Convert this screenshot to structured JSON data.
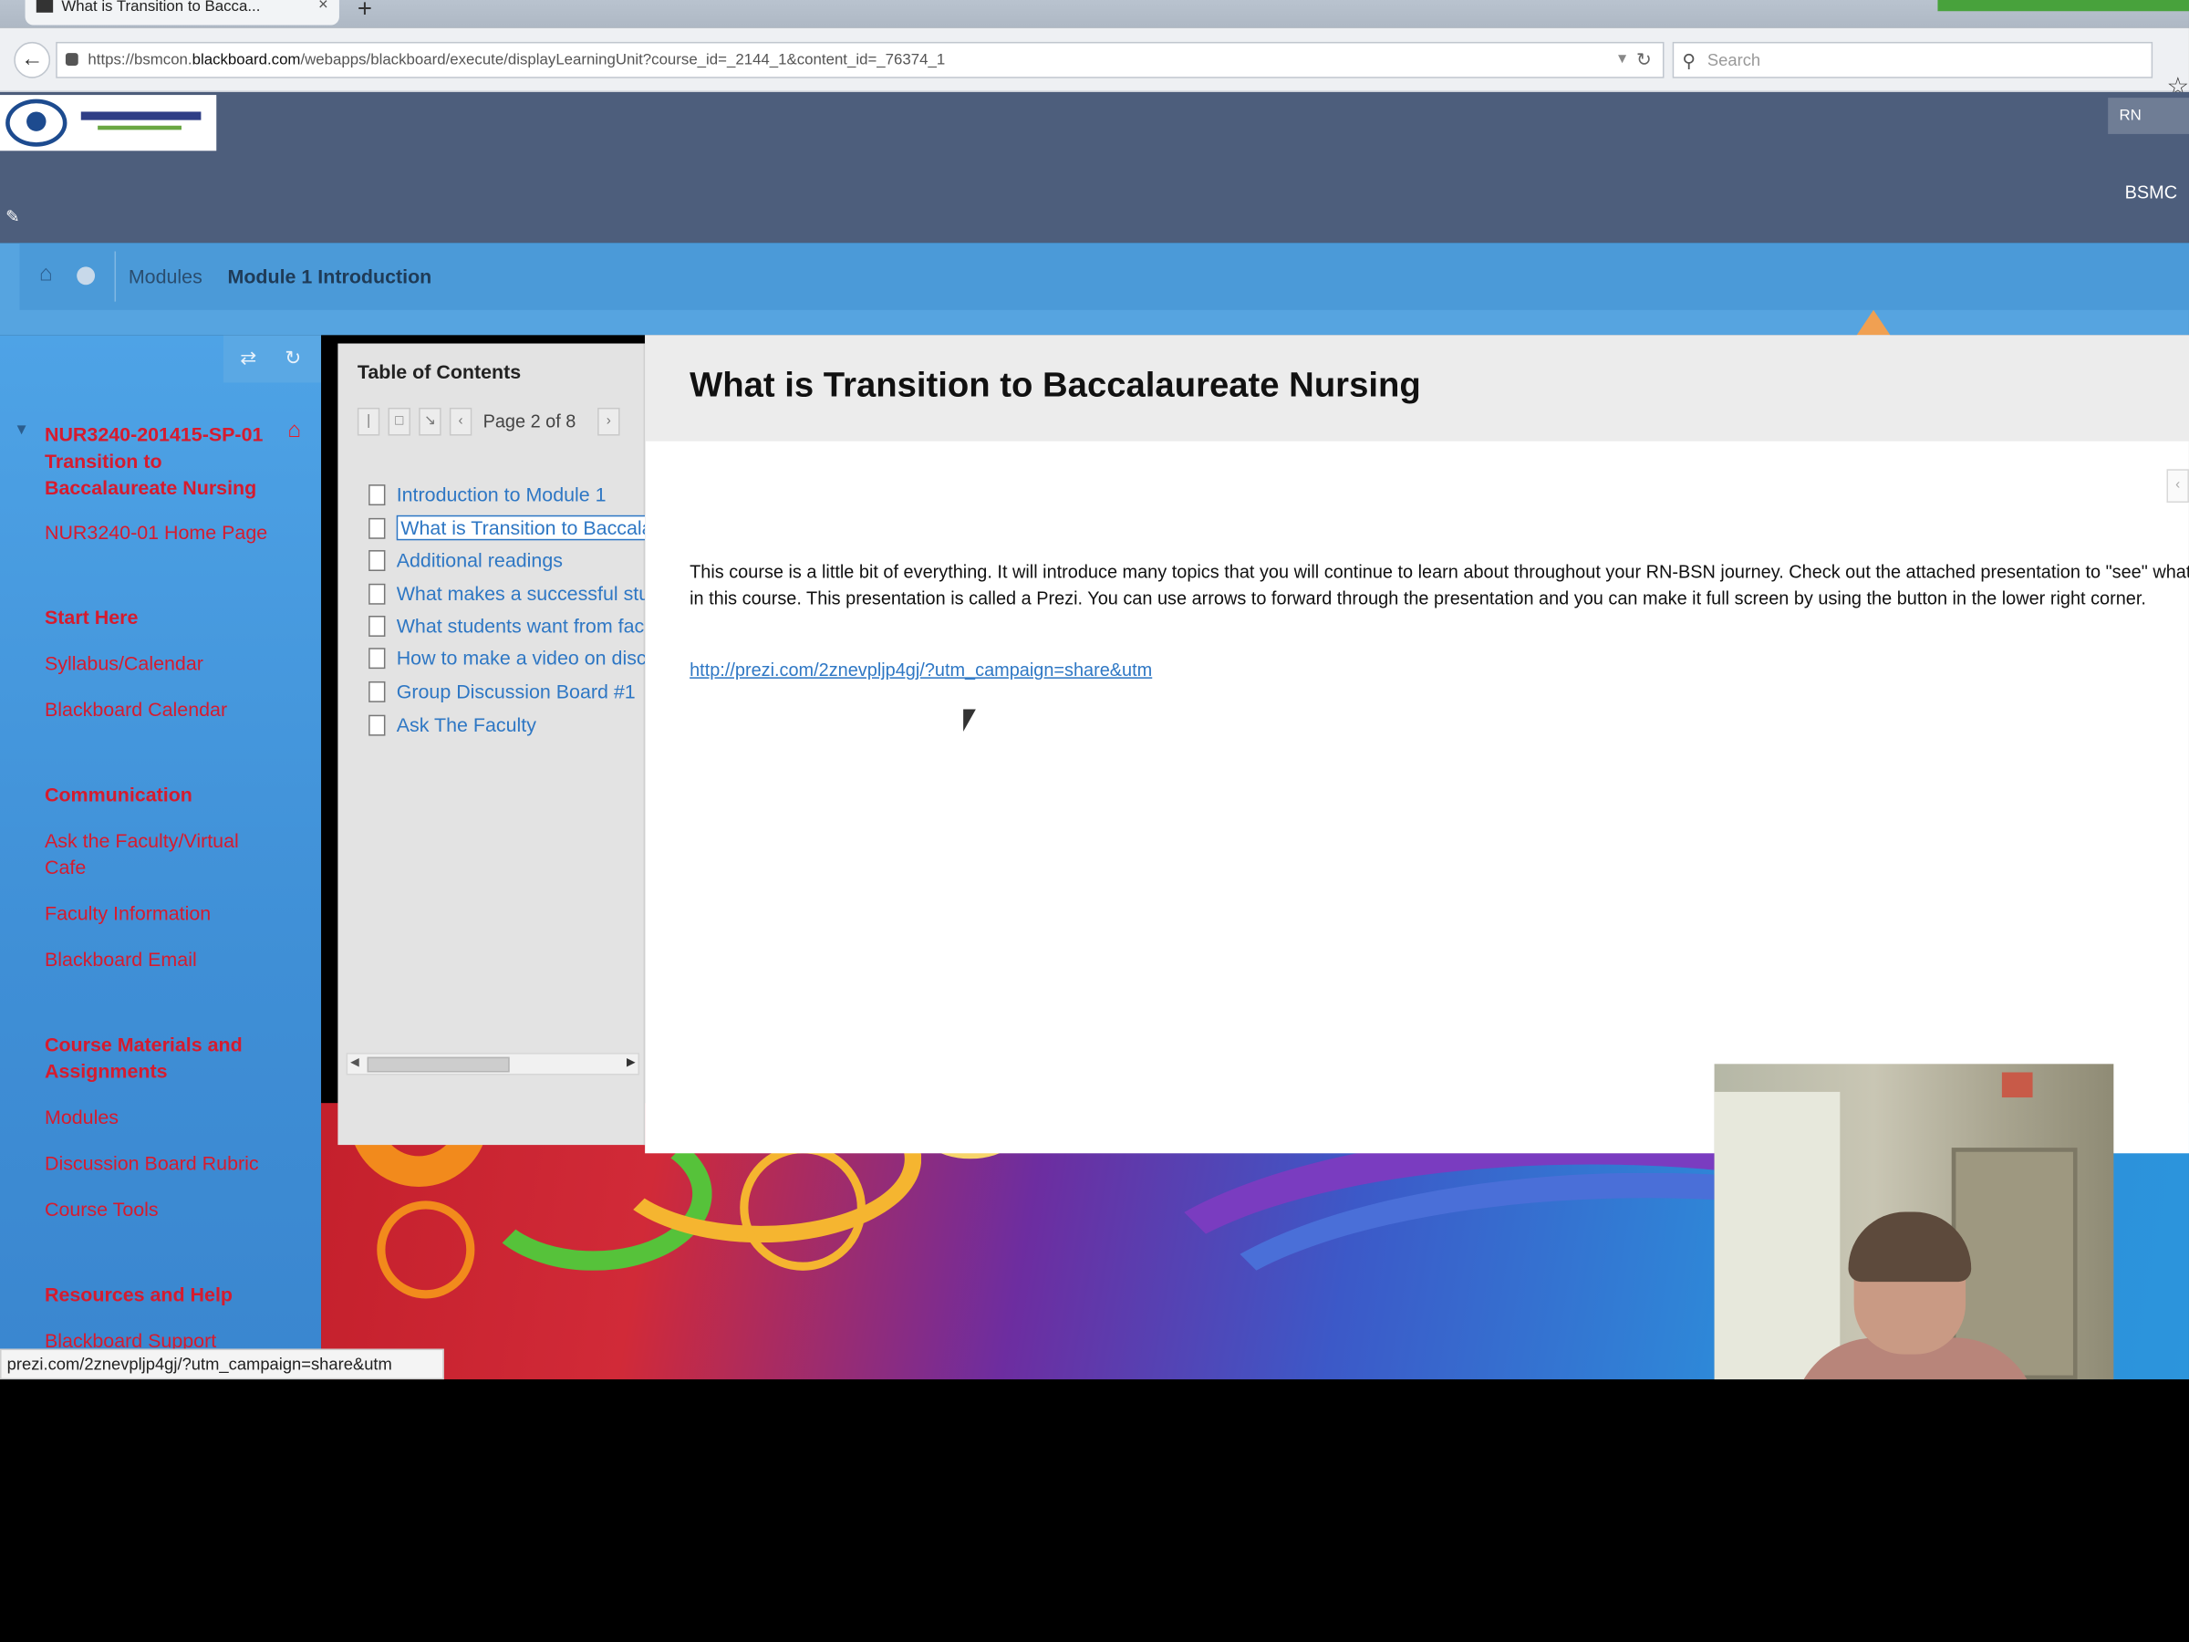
{
  "browser": {
    "tab_title": "What is Transition to Bacca...",
    "tab_close": "×",
    "new_tab": "+",
    "url_prefix": "https://bsmcon.",
    "url_domain": "blackboard.com",
    "url_rest": "/webapps/blackboard/execute/displayLearningUnit?course_id=_2144_1&content_id=_76374_1",
    "search_placeholder": "Search"
  },
  "header": {
    "right_tab_label": "RN",
    "org_label": "BSMC"
  },
  "breadcrumb": {
    "items": [
      "Modules",
      "Module 1 Introduction"
    ]
  },
  "sidebar": {
    "course_title": "NUR3240-201415-SP-01 Transition to Baccalaureate Nursing",
    "items": [
      {
        "label": "NUR3240-01 Home Page",
        "type": "link"
      },
      {
        "label": "Start Here",
        "type": "head"
      },
      {
        "label": "Syllabus/Calendar",
        "type": "link"
      },
      {
        "label": "Blackboard Calendar",
        "type": "link"
      },
      {
        "label": "Communication",
        "type": "head"
      },
      {
        "label": "Ask the Faculty/Virtual Cafe",
        "type": "link"
      },
      {
        "label": "Faculty Information",
        "type": "link"
      },
      {
        "label": "Blackboard Email",
        "type": "link"
      },
      {
        "label": "Course Materials and Assignments",
        "type": "head"
      },
      {
        "label": "Modules",
        "type": "link"
      },
      {
        "label": "Discussion Board Rubric",
        "type": "link"
      },
      {
        "label": "Course Tools",
        "type": "link"
      },
      {
        "label": "Resources and Help",
        "type": "head"
      },
      {
        "label": "Blackboard Support",
        "type": "link"
      }
    ]
  },
  "toc": {
    "title": "Table of Contents",
    "page_label": "Page 2 of 8",
    "current_page": 2,
    "total_pages": 8,
    "items": [
      "Introduction to Module 1",
      "What is Transition to Baccalaureate Nursing",
      "Additional readings",
      "What makes a successful student",
      "What students want from faculty",
      "How to make a video on discussion board",
      "Group Discussion Board #1",
      "Ask The Faculty"
    ]
  },
  "content": {
    "title": "What is Transition to Baccalaureate Nursing",
    "body": "This course is a little bit of everything. It will introduce many topics that you will continue to learn about throughout your RN-BSN journey. Check out the attached presentation to \"see\" what is in this course. This presentation is called a Prezi. You can use arrows to forward through the presentation and you can make it full screen by using the button in the lower right corner.",
    "link": "http://prezi.com/2znevpljp4gj/?utm_campaign=share&utm"
  },
  "status_bar": {
    "text": "prezi.com/2znevpljp4gj/?utm_campaign=share&utm"
  }
}
